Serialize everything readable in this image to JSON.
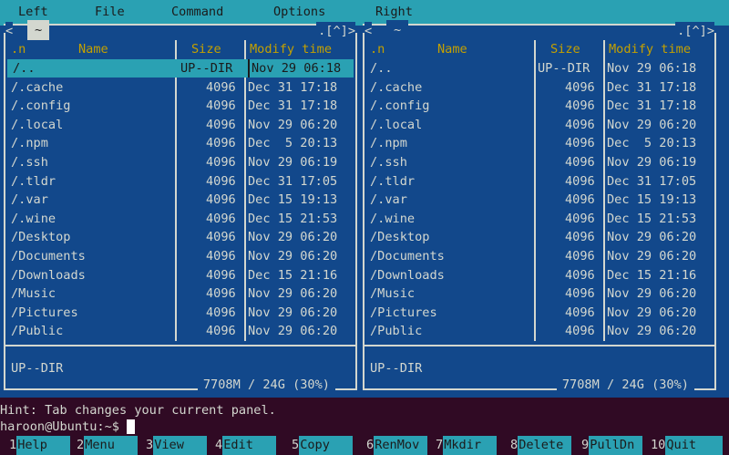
{
  "menu": [
    "Left",
    "File",
    "Command",
    "Options",
    "Right"
  ],
  "left": {
    "path": "~",
    "top_right": ".[^]>",
    "top_left": "<",
    "footer_status": "UP--DIR",
    "disk": "7708M / 24G (30%)"
  },
  "right": {
    "path": "~",
    "top_right": ".[^]>",
    "top_left": "<",
    "footer_status": "UP--DIR",
    "disk": "7708M / 24G (30%)"
  },
  "headers": {
    "sort": ".n",
    "name": "Name",
    "size": "Size",
    "time": "Modify time"
  },
  "files": [
    [
      "/..",
      "UP--DIR",
      "Nov 29 06:18"
    ],
    [
      "/.cache",
      "4096",
      "Dec 31 17:18"
    ],
    [
      "/.config",
      "4096",
      "Dec 31 17:18"
    ],
    [
      "/.local",
      "4096",
      "Nov 29 06:20"
    ],
    [
      "/.npm",
      "4096",
      "Dec  5 20:13"
    ],
    [
      "/.ssh",
      "4096",
      "Nov 29 06:19"
    ],
    [
      "/.tldr",
      "4096",
      "Dec 31 17:05"
    ],
    [
      "/.var",
      "4096",
      "Dec 15 19:13"
    ],
    [
      "/.wine",
      "4096",
      "Dec 15 21:53"
    ],
    [
      "/Desktop",
      "4096",
      "Nov 29 06:20"
    ],
    [
      "/Documents",
      "4096",
      "Nov 29 06:20"
    ],
    [
      "/Downloads",
      "4096",
      "Dec 15 21:16"
    ],
    [
      "/Music",
      "4096",
      "Nov 29 06:20"
    ],
    [
      "/Pictures",
      "4096",
      "Nov 29 06:20"
    ],
    [
      "/Public",
      "4096",
      "Nov 29 06:20"
    ]
  ],
  "hint": "Hint: Tab changes your current panel.",
  "prompt": "haroon@Ubuntu:~$",
  "fkeys": [
    [
      "1",
      "Help"
    ],
    [
      "2",
      "Menu"
    ],
    [
      "3",
      "View"
    ],
    [
      "4",
      "Edit"
    ],
    [
      "5",
      "Copy"
    ],
    [
      "6",
      "RenMov"
    ],
    [
      "7",
      "Mkdir"
    ],
    [
      "8",
      "Delete"
    ],
    [
      "9",
      "PullDn"
    ],
    [
      "10",
      "Quit"
    ]
  ],
  "colors": {
    "panel": "#12488b",
    "accent": "#2aa1b3",
    "header": "#c4a000",
    "terminal": "#300a24"
  }
}
